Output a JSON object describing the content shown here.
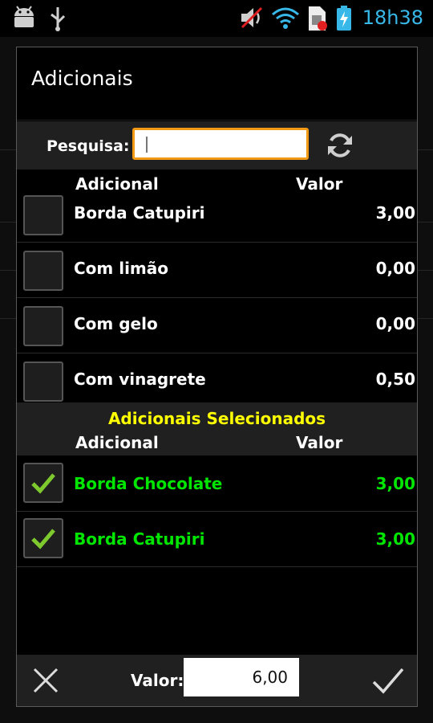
{
  "status_bar": {
    "time": "18h38",
    "time_color": "#38b8e8"
  },
  "dialog": {
    "title": "Adicionais",
    "search": {
      "label": "Pesquisa:",
      "value": "",
      "placeholder": ""
    },
    "columns": {
      "name": "Adicional",
      "value": "Valor"
    },
    "items": [
      {
        "name": "Borda Catupiri",
        "value": "3,00",
        "checked": false
      },
      {
        "name": "Com limão",
        "value": "0,00",
        "checked": false
      },
      {
        "name": "Com gelo",
        "value": "0,00",
        "checked": false
      },
      {
        "name": "Com vinagrete",
        "value": "0,50",
        "checked": false
      }
    ],
    "selected": {
      "title": "Adicionais Selecionados",
      "columns": {
        "name": "Adicional",
        "value": "Valor"
      },
      "items": [
        {
          "name": "Borda Chocolate",
          "value": "3,00",
          "checked": true
        },
        {
          "name": "Borda Catupiri",
          "value": "3,00",
          "checked": true
        }
      ]
    },
    "footer": {
      "total_label": "Valor:",
      "total_value": "6,00"
    },
    "colors": {
      "accent_orange": "#f29a16",
      "selected_green": "#00e600",
      "section_yellow": "#ffff00"
    }
  }
}
